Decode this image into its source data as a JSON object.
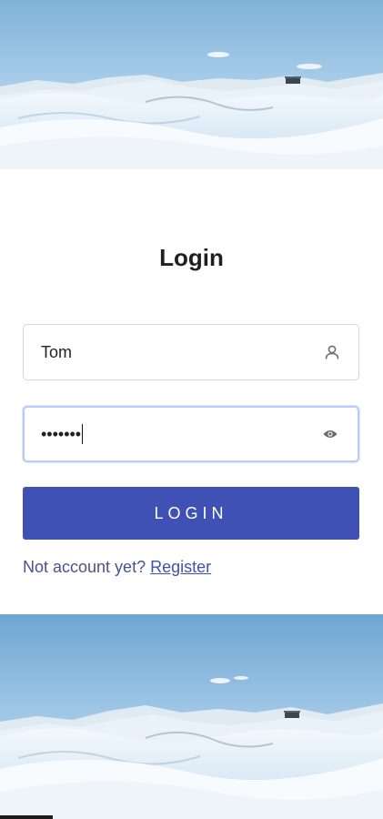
{
  "banner": {
    "description": "snow-mountain-image"
  },
  "login": {
    "title": "Login",
    "username_value": "Tom",
    "password_value": "•••••••",
    "button_label": "LOGIN",
    "prompt_text": "Not account yet?",
    "register_link": "Register"
  },
  "icons": {
    "username": "user-icon",
    "password": "eye-icon"
  },
  "colors": {
    "primary": "#3f51b5",
    "focus_border": "#b7cdf5",
    "link": "#3f51b5"
  }
}
